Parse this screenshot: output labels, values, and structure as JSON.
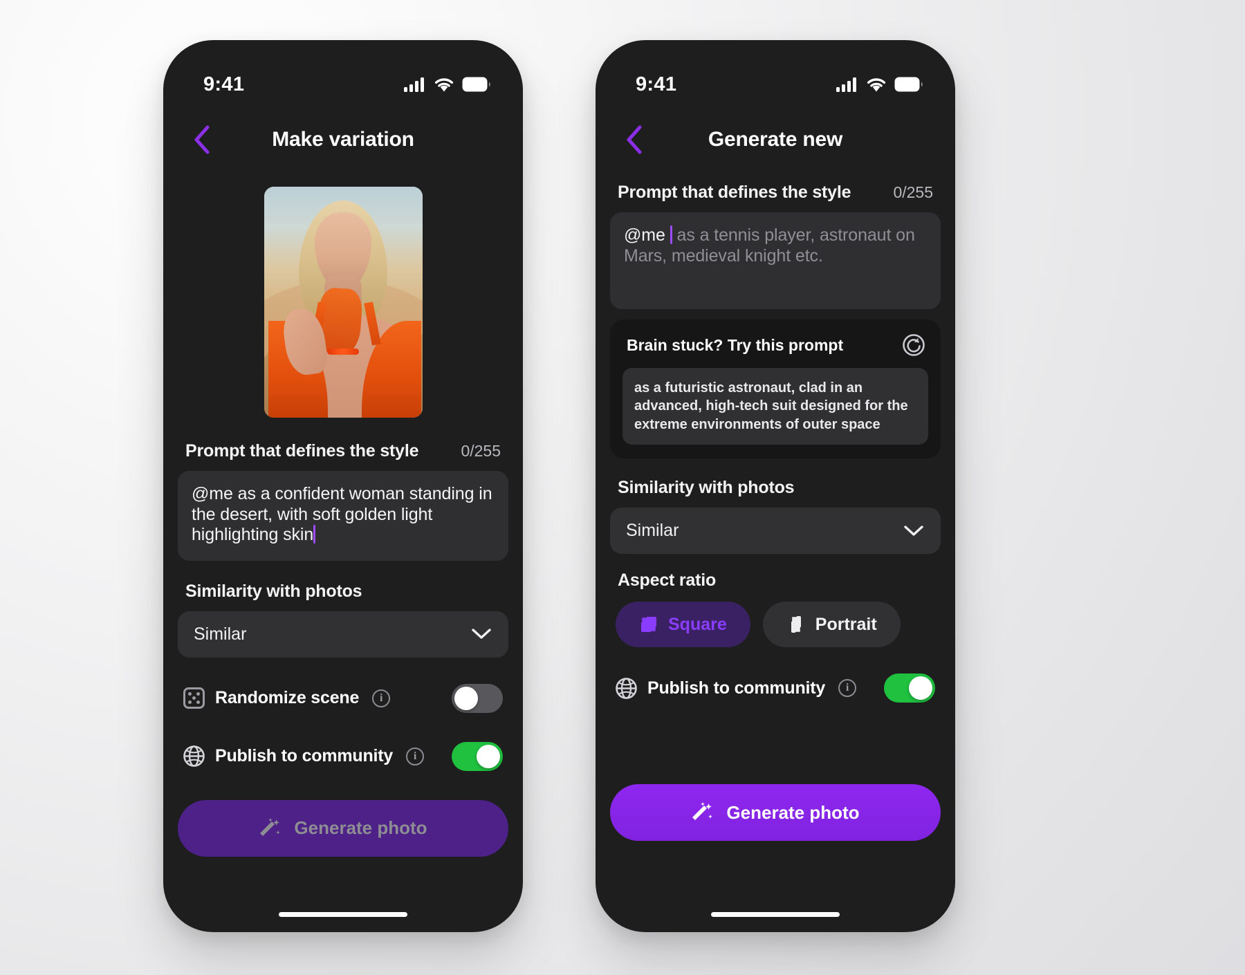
{
  "status": {
    "time": "9:41",
    "cellular_icon": "cellular-bars-icon",
    "wifi_icon": "wifi-icon",
    "battery_icon": "battery-full-icon"
  },
  "screens": [
    {
      "id": "make-variation",
      "title": "Make variation",
      "back_icon": "chevron-left-icon",
      "preview_image_alt": "Generated portrait of a blonde woman in an orange dress standing in a desert",
      "prompt": {
        "label": "Prompt that defines the style",
        "counter": "0/255",
        "value": "@me as a confident woman standing in the desert, with soft golden light highlighting skin",
        "placeholder": "@me as a tennis player, astronaut on Mars, medieval knight etc."
      },
      "similarity": {
        "label": "Similarity with photos",
        "value": "Similar",
        "chevron_icon": "chevron-down-icon"
      },
      "toggles": [
        {
          "icon": "dice-icon",
          "label": "Randomize scene",
          "info_icon": "info-icon",
          "state": "off"
        },
        {
          "icon": "globe-icon",
          "label": "Publish to community",
          "info_icon": "info-icon",
          "state": "on"
        }
      ],
      "cta": {
        "label": "Generate photo",
        "icon": "magic-wand-icon",
        "state": "disabled"
      }
    },
    {
      "id": "generate-new",
      "title": "Generate new",
      "back_icon": "chevron-left-icon",
      "prompt": {
        "label": "Prompt that defines the style",
        "counter": "0/255",
        "typed": "@me",
        "placeholder": "as a tennis player, astronaut on Mars, medieval knight etc."
      },
      "suggestion": {
        "title": "Brain stuck? Try this prompt",
        "refresh_icon": "refresh-icon",
        "text": "as a futuristic astronaut, clad in an advanced, high-tech suit designed for the extreme environments of outer space"
      },
      "similarity": {
        "label": "Similarity with photos",
        "value": "Similar",
        "chevron_icon": "chevron-down-icon"
      },
      "aspect_ratio": {
        "label": "Aspect ratio",
        "options": [
          {
            "label": "Square",
            "icon": "square-crop-icon",
            "selected": true
          },
          {
            "label": "Portrait",
            "icon": "portrait-crop-icon",
            "selected": false
          }
        ]
      },
      "toggles": [
        {
          "icon": "globe-icon",
          "label": "Publish to community",
          "info_icon": "info-icon",
          "state": "on"
        }
      ],
      "cta": {
        "label": "Generate photo",
        "icon": "magic-wand-icon",
        "state": "enabled"
      }
    }
  ],
  "colors": {
    "accent_purple": "#8B2FE8",
    "accent_purple_light": "#8B3DFF",
    "toggle_on_green": "#1FC13F",
    "screen_bg": "#1E1E1F",
    "field_bg": "#2F2F31",
    "card_bg": "#161617"
  }
}
